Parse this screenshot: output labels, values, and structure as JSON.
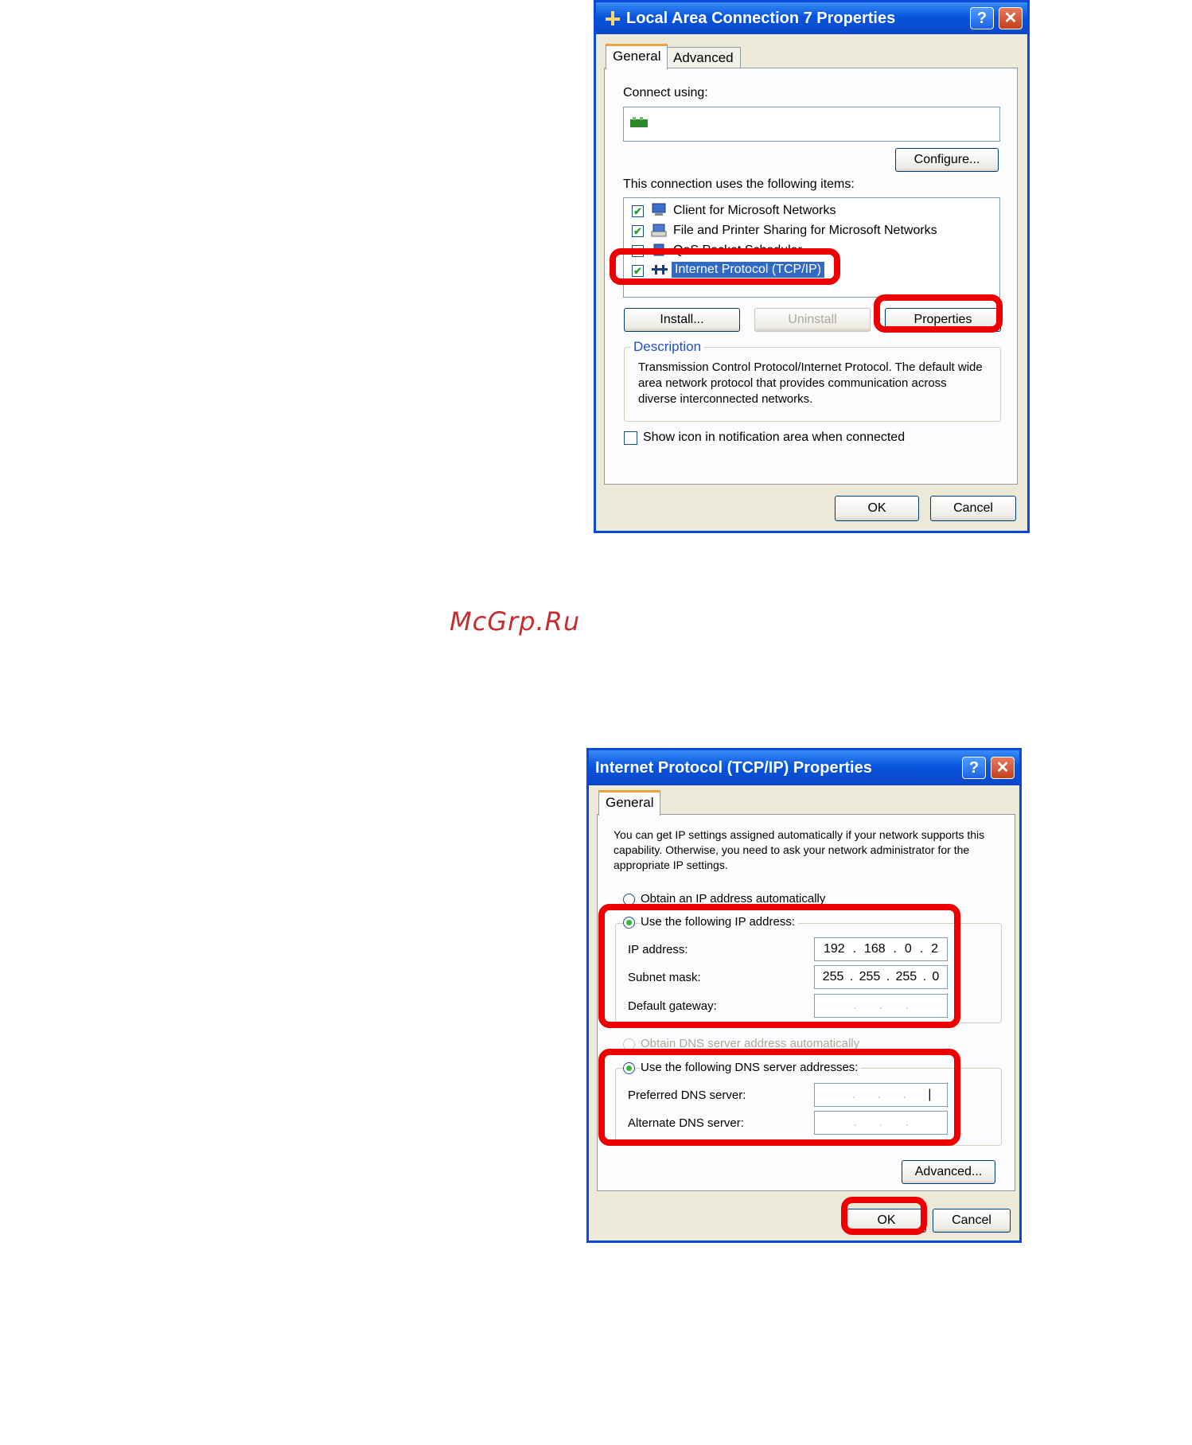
{
  "dialog1": {
    "title": "Local Area Connection 7 Properties",
    "tabs": [
      "General",
      "Advanced"
    ],
    "connect_using_label": "Connect using:",
    "configure_button": "Configure...",
    "items_label": "This connection uses the following items:",
    "items": [
      {
        "label": "Client for Microsoft Networks",
        "checked": true
      },
      {
        "label": "File and Printer Sharing for Microsoft Networks",
        "checked": true
      },
      {
        "label": "QoS Packet Scheduler",
        "checked": true
      },
      {
        "label": "Internet Protocol (TCP/IP)",
        "checked": true,
        "selected": true
      }
    ],
    "install_button": "Install...",
    "uninstall_button": "Uninstall",
    "properties_button": "Properties",
    "description_title": "Description",
    "description_text": "Transmission Control Protocol/Internet Protocol. The default wide area network protocol that provides communication across diverse interconnected networks.",
    "show_icon_label": "Show icon in notification area when connected",
    "ok_button": "OK",
    "cancel_button": "Cancel"
  },
  "watermark": "McGrp.Ru",
  "dialog2": {
    "title": "Internet Protocol (TCP/IP) Properties",
    "tab": "General",
    "intro_text": "You can get IP settings assigned automatically if your network supports this capability. Otherwise, you need to ask your network administrator for the appropriate IP settings.",
    "obtain_ip_auto": "Obtain an IP address automatically",
    "use_following_ip": "Use the following IP address:",
    "ip_address_label": "IP address:",
    "ip_address": [
      "192",
      "168",
      "0",
      "2"
    ],
    "subnet_mask_label": "Subnet mask:",
    "subnet_mask": [
      "255",
      "255",
      "255",
      "0"
    ],
    "default_gateway_label": "Default gateway:",
    "obtain_dns_auto": "Obtain DNS server address automatically",
    "use_following_dns": "Use the following DNS server addresses:",
    "preferred_dns_label": "Preferred DNS server:",
    "alternate_dns_label": "Alternate DNS server:",
    "advanced_button": "Advanced...",
    "ok_button": "OK",
    "cancel_button": "Cancel"
  },
  "colors": {
    "highlight": "#ee0000",
    "titlebar": "#0855dd",
    "selection": "#316ac5"
  }
}
